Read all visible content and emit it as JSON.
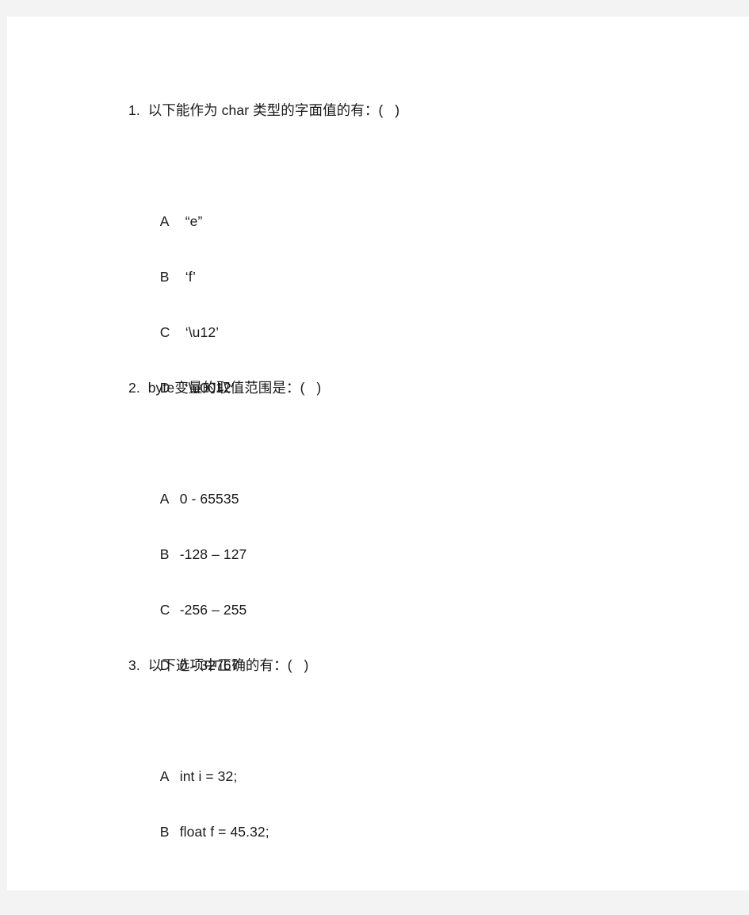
{
  "document": {
    "background_color": "#f3f3f4",
    "page_color": "#ffffff",
    "text_color": "#191919",
    "questions": [
      {
        "number": "1.",
        "stem": "1.  以下能作为 char 类型的字面值的有：(   )",
        "option_gap": "wide",
        "options": [
          {
            "letter": "A",
            "value": "“e”"
          },
          {
            "letter": "B",
            "value": "‘f’"
          },
          {
            "letter": "C",
            "value": "‘\\u12’"
          },
          {
            "letter": "D",
            "value": "‘\\u0012’"
          }
        ]
      },
      {
        "number": "2.",
        "stem": "2.  byte变量的取值范围是：(   )",
        "option_gap": "narrow",
        "options": [
          {
            "letter": "A",
            "value": "0 - 65535"
          },
          {
            "letter": "B",
            "value": "-128 – 127"
          },
          {
            "letter": "C",
            "value": "-256 – 255"
          },
          {
            "letter": "D",
            "value": "0 - 32767"
          }
        ]
      },
      {
        "number": "3.",
        "stem": "3.  以下选项中正确的有：(   )",
        "option_gap": "narrow",
        "options": [
          {
            "letter": "A",
            "value": "int i = 32;"
          },
          {
            "letter": "B",
            "value": "float f = 45.32;"
          }
        ]
      }
    ]
  }
}
